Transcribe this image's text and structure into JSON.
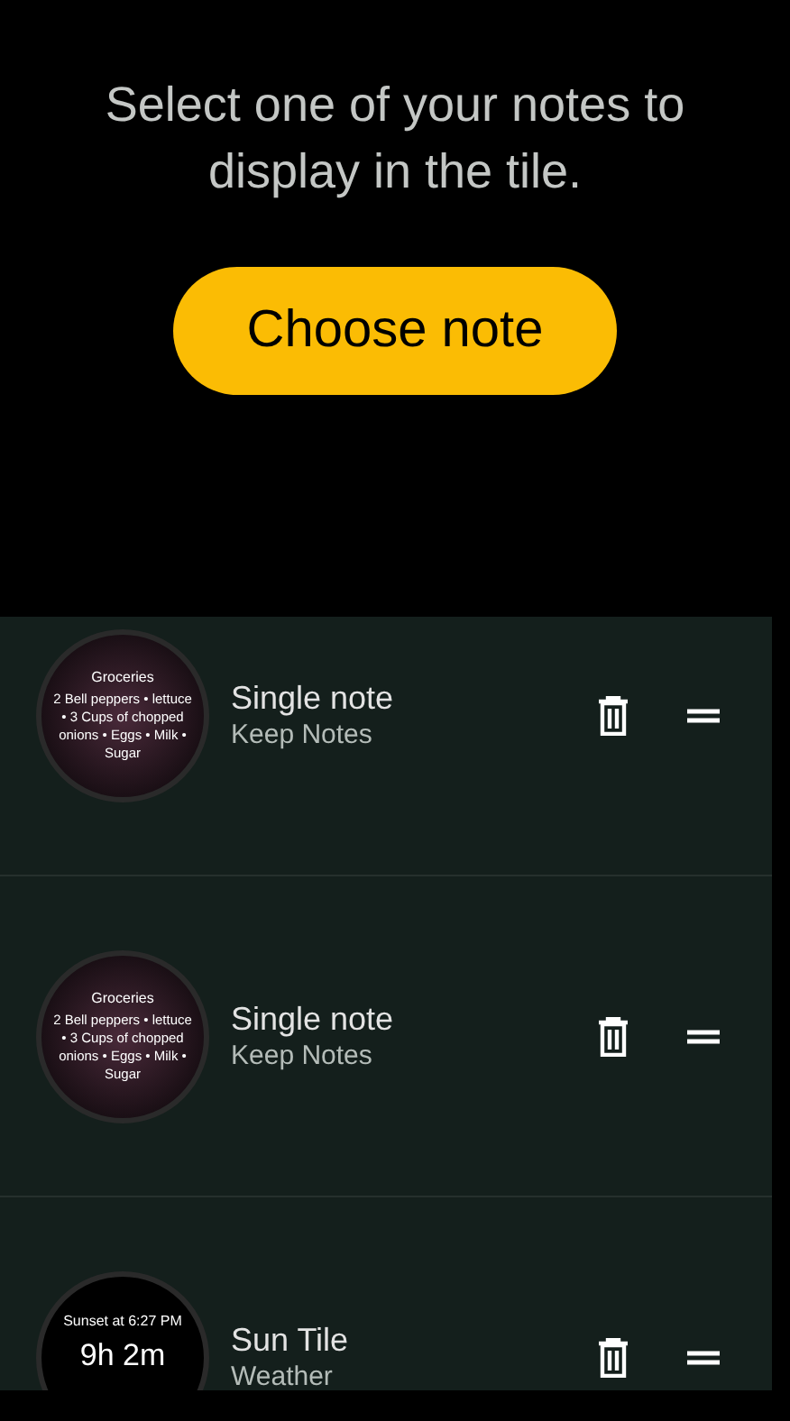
{
  "prompt": "Select one of your notes to display in the tile.",
  "choose_button": "Choose note",
  "tiles": [
    {
      "kind": "note",
      "preview_title": "Groceries",
      "preview_body": "2 Bell peppers • lettuce • 3 Cups of chopped onions • Eggs • Milk • Sugar",
      "title": "Single note",
      "app": "Keep Notes"
    },
    {
      "kind": "note",
      "preview_title": "Groceries",
      "preview_body": "2 Bell peppers • lettuce • 3 Cups of chopped onions • Eggs • Milk • Sugar",
      "title": "Single note",
      "app": "Keep Notes"
    },
    {
      "kind": "sun",
      "preview_title": "Sunset at 6:27 PM",
      "preview_body": "9h 2m",
      "title": "Sun Tile",
      "app": "Weather"
    }
  ]
}
